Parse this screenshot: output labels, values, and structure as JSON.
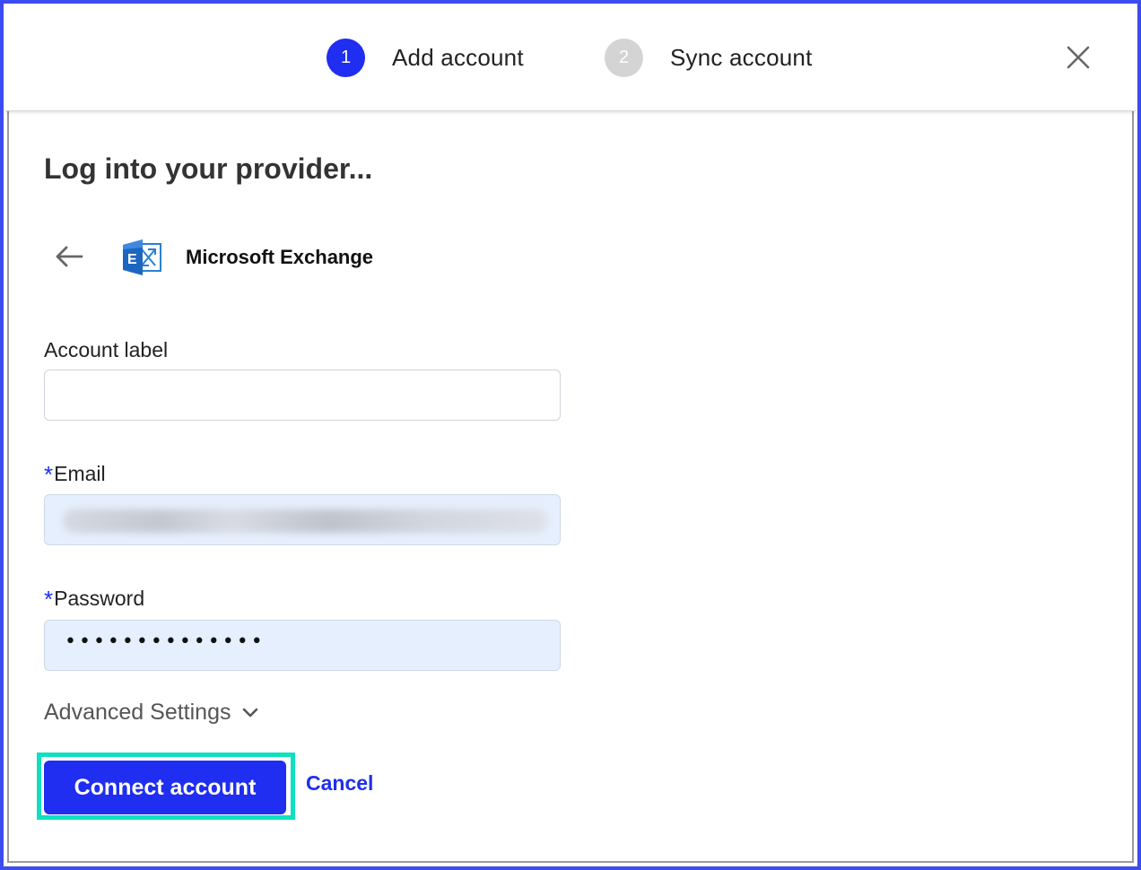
{
  "stepper": {
    "steps": [
      {
        "number": "1",
        "label": "Add account",
        "state": "active"
      },
      {
        "number": "2",
        "label": "Sync account",
        "state": "inactive"
      }
    ],
    "close_icon": "close-icon"
  },
  "title": "Log into your provider...",
  "provider": {
    "back_icon": "arrow-left-icon",
    "logo_icon": "microsoft-exchange-icon",
    "name": "Microsoft Exchange"
  },
  "form": {
    "account_label": {
      "label": "Account label",
      "value": ""
    },
    "email": {
      "required_mark": "*",
      "label": "Email",
      "value": ""
    },
    "password": {
      "required_mark": "*",
      "label": "Password",
      "value": "••••••••••••••"
    }
  },
  "advanced": {
    "label": "Advanced Settings",
    "icon": "chevron-down-icon"
  },
  "actions": {
    "connect_label": "Connect account",
    "cancel_label": "Cancel"
  },
  "colors": {
    "accent": "#1f2ef0",
    "highlight": "#10e0c0",
    "filled_input": "#e6effd"
  }
}
